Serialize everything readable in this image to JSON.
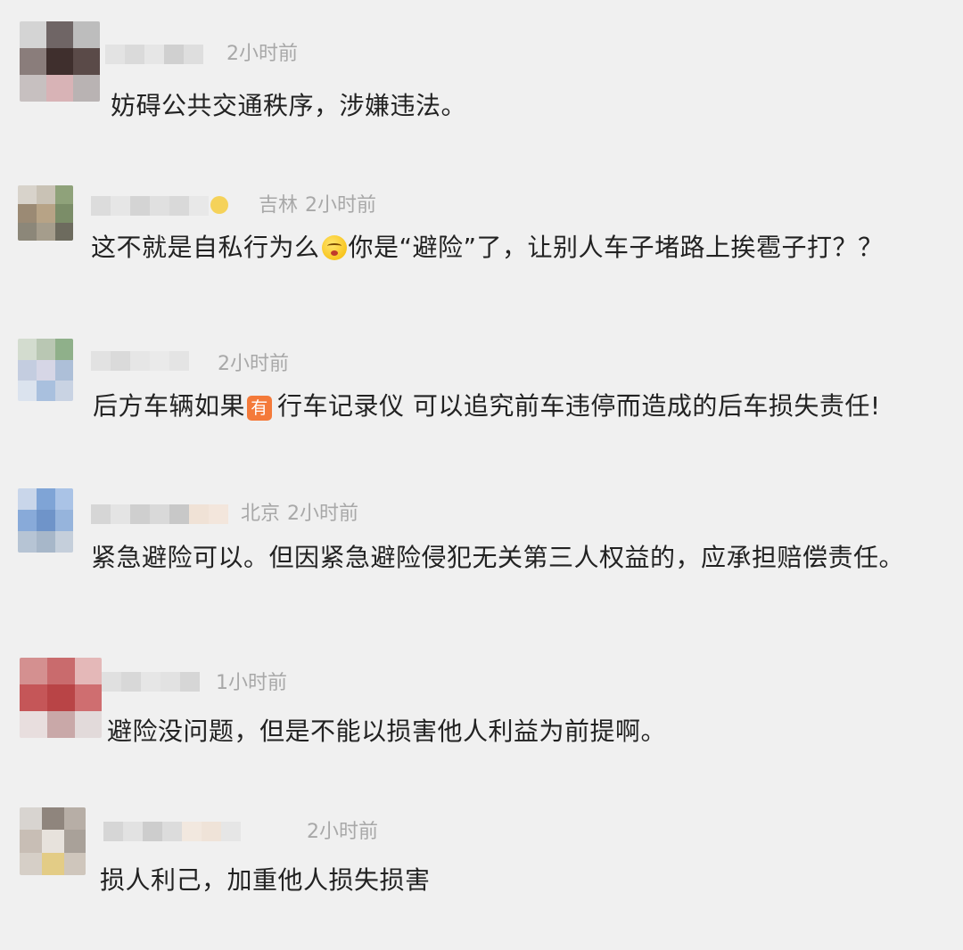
{
  "comments": [
    {
      "meta": {
        "location": "",
        "time": "2小时前"
      },
      "text": [
        "妨碍公共交通秩序，涉嫌违法。"
      ]
    },
    {
      "meta": {
        "location": "吉林",
        "time": "2小时前"
      },
      "text": [
        "这不就是自私行为么",
        "你是“避险”了，让别人车子堵路上挨雹子打？？"
      ],
      "emoji": "face-emoji"
    },
    {
      "meta": {
        "location": "",
        "time": "2小时前"
      },
      "text": [
        "后方车辆如果",
        "行车记录仪 可以追究前车违停而造成的后车损失责任!"
      ],
      "tag": "有"
    },
    {
      "meta": {
        "location": "北京",
        "time": "2小时前"
      },
      "text": [
        "紧急避险可以。但因紧急避险侵犯无关第三人权益的，应承担赔偿责任。"
      ]
    },
    {
      "meta": {
        "location": "",
        "time": "1小时前"
      },
      "text": [
        "避险没问题，但是不能以损害他人利益为前提啊。"
      ]
    },
    {
      "meta": {
        "location": "",
        "time": "2小时前"
      },
      "text": [
        "损人利己，加重他人损失损害"
      ]
    }
  ],
  "colors": {
    "background": "#f0f0f0",
    "text": "#222222",
    "meta": "#a8a8a8",
    "tag": "#f47a3a"
  }
}
